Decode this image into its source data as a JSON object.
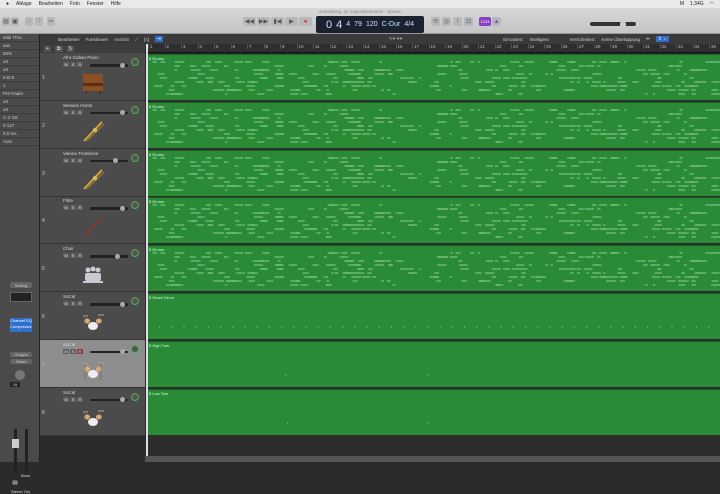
{
  "menubar": {
    "items": [
      "Ablage",
      "Bearbeiten",
      "Foto",
      "Fenster",
      "Hilfe"
    ],
    "status": [
      "M",
      "1.34G"
    ]
  },
  "window_title": "Anmeldung, du Jugendtrommeln - Spuren",
  "lcd": {
    "bar": "0",
    "beat": "4",
    "sub": "4",
    "tick": "79",
    "tempo": "120",
    "key": "C-Dur",
    "signature": "4/4"
  },
  "toolbar2": {
    "edit": "Bearbeiten",
    "functions": "Funktionen",
    "view": "Ansicht",
    "snap_label": "Einrasten:",
    "snap_value": "Intelligent",
    "drag_label": "Verschieben:",
    "drag_value": "Keine Überlappung"
  },
  "inspector": {
    "top": "Midi Thru",
    "rows": [
      "aus",
      "50%",
      "±0",
      "±0",
      "Inst 8",
      "1",
      "Pre-Fader",
      "±0",
      "±0",
      "C-2 G8",
      "0 127",
      "0,0 ms",
      "Auto"
    ],
    "setting": "Setting",
    "eq": "Channel EQ",
    "comp": "Compressor",
    "group": "Gruppe",
    "automation": "Read",
    "bounce": "Bnce",
    "mute": "M",
    "output": "Stereo Out",
    "s_btn": "S",
    "lcd_num": "16"
  },
  "ruler": {
    "bars": [
      "1",
      "2",
      "3",
      "4",
      "5",
      "6",
      "7",
      "8",
      "9",
      "10",
      "11",
      "12",
      "13",
      "14",
      "15",
      "16",
      "17",
      "18",
      "19",
      "20",
      "21",
      "22",
      "23",
      "24",
      "25",
      "26",
      "27",
      "28",
      "29",
      "30",
      "31",
      "32",
      "33",
      "34",
      "35"
    ]
  },
  "tracks": [
    {
      "num": "1",
      "name": "Afro-Cuban Piano",
      "vol": 0.9,
      "region": "8 Drums",
      "icon": "piano"
    },
    {
      "num": "2",
      "name": "Session Horns",
      "vol": 0.9,
      "region": "8 Drums",
      "icon": "trombone"
    },
    {
      "num": "3",
      "name": "Vienna Trombone",
      "vol": 0.7,
      "region": "8 Drums",
      "icon": "trombone"
    },
    {
      "num": "4",
      "name": "Flöte",
      "vol": 0.9,
      "region": "8 Drums",
      "icon": "flute"
    },
    {
      "num": "5",
      "name": "Choir",
      "vol": 0.75,
      "region": "8 Drums",
      "icon": "choir"
    },
    {
      "num": "6",
      "name": "SoCal",
      "vol": 0.9,
      "region": "8 Snare Drum",
      "icon": "drums"
    },
    {
      "num": "7",
      "name": "SoCal",
      "vol": 0.9,
      "region": "8 High Tom",
      "icon": "drums",
      "selected": true
    },
    {
      "num": "8",
      "name": "SoCal",
      "vol": 0.9,
      "region": "8 Low Tom",
      "icon": "drums"
    }
  ],
  "colors": {
    "region": "#2a8b37",
    "note": "#b6e7b9"
  }
}
